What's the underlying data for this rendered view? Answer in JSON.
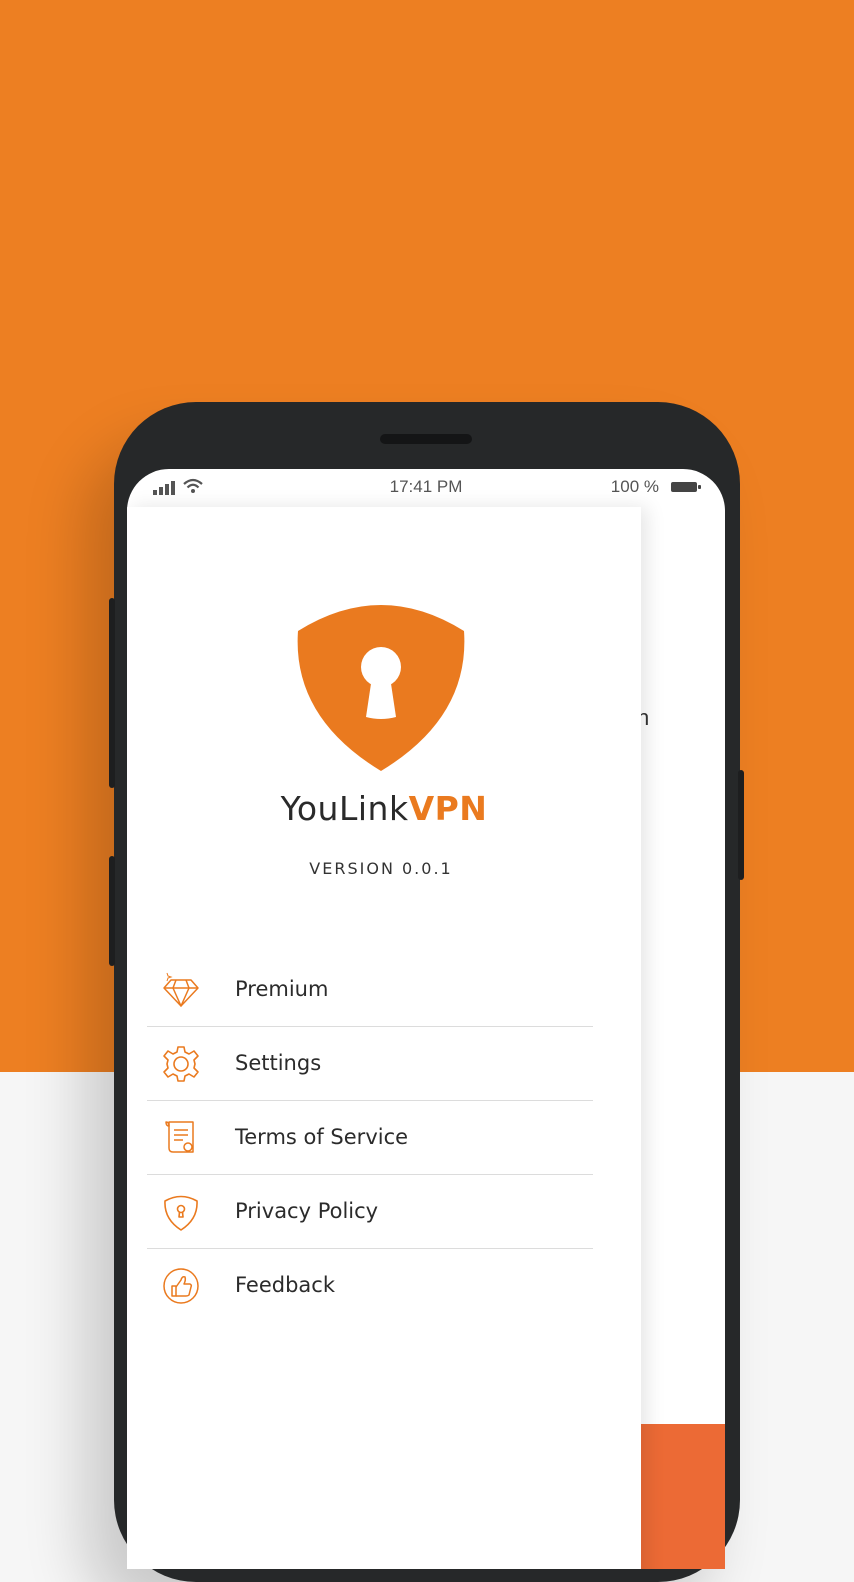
{
  "status_bar": {
    "time": "17:41 PM",
    "battery_text": "100 %",
    "icons": [
      "signal-icon",
      "wifi-icon",
      "battery-icon"
    ]
  },
  "drawer": {
    "brand_primary": "YouLink",
    "brand_accent": "VPN",
    "version": "VERSION 0.0.1",
    "menu": [
      {
        "label": "Premium",
        "icon": "diamond-icon"
      },
      {
        "label": "Settings",
        "icon": "gear-icon"
      },
      {
        "label": "Terms of Service",
        "icon": "document-icon"
      },
      {
        "label": "Privacy Policy",
        "icon": "shield-lock-icon"
      },
      {
        "label": "Feedback",
        "icon": "thumbs-up-icon"
      }
    ]
  },
  "background_partial_text": "n",
  "colors": {
    "accent": "#ea7a1f",
    "background_orange": "#ed7f22",
    "phone_body": "#262829"
  }
}
